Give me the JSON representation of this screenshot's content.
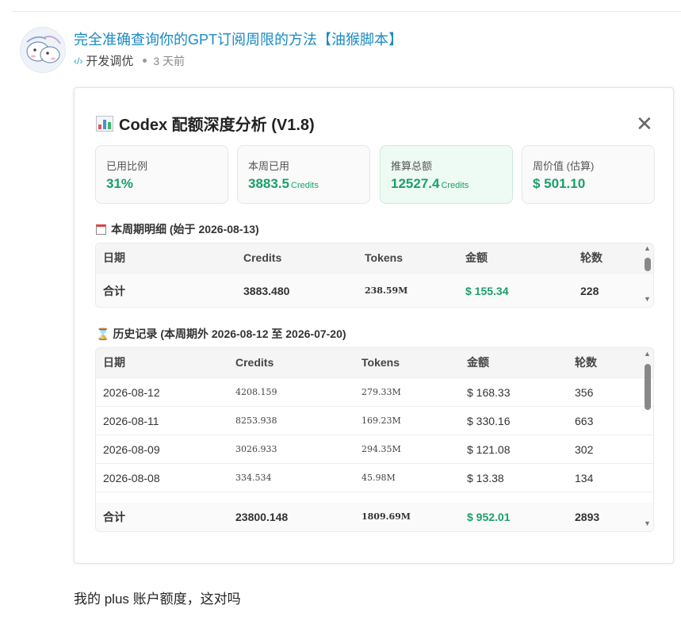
{
  "post": {
    "title": "完全准确查询你的GPT订阅周限的方法【油猴脚本】",
    "category": "开发调优",
    "time": "3 天前",
    "caption": "我的 plus 账户额度，这对吗"
  },
  "panel": {
    "title": "Codex 配额深度分析 (V1.8)",
    "close": "✕",
    "cards": [
      {
        "label": "已用比例",
        "value": "31%",
        "unit": ""
      },
      {
        "label": "本周已用",
        "value": "3883.5",
        "unit": "Credits"
      },
      {
        "label": "推算总额",
        "value": "12527.4",
        "unit": "Credits"
      },
      {
        "label": "周价值 (估算)",
        "value": "$ 501.10",
        "unit": ""
      }
    ],
    "week": {
      "title": "本周期明细 (始于 2026-08-13)",
      "headers": [
        "日期",
        "Credits",
        "Tokens",
        "金额",
        "轮数"
      ],
      "total": [
        "合计",
        "3883.480",
        "238.59M",
        "$ 155.34",
        "228"
      ]
    },
    "history": {
      "title": "历史记录 (本周期外 2026-08-12 至 2026-07-20)",
      "headers": [
        "日期",
        "Credits",
        "Tokens",
        "金额",
        "轮数"
      ],
      "rows": [
        [
          "2026-08-12",
          "4208.159",
          "279.33M",
          "$ 168.33",
          "356"
        ],
        [
          "2026-08-11",
          "8253.938",
          "169.23M",
          "$ 330.16",
          "663"
        ],
        [
          "2026-08-09",
          "3026.933",
          "294.35M",
          "$ 121.08",
          "302"
        ],
        [
          "2026-08-08",
          "334.534",
          "45.98M",
          "$ 13.38",
          "134"
        ]
      ],
      "total": [
        "合计",
        "23800.148",
        "1809.69M",
        "$ 952.01",
        "2893"
      ]
    }
  },
  "colors": {
    "accent": "#1aa06a",
    "link": "#1a8bc4"
  }
}
